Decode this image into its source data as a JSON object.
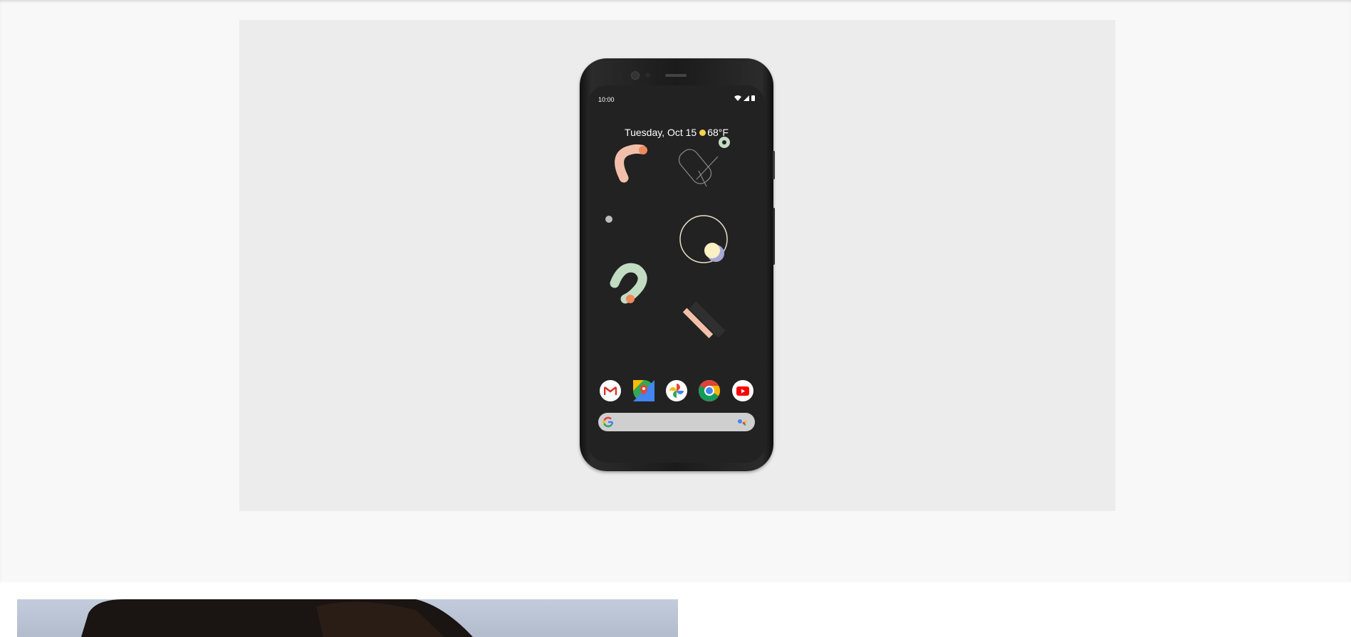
{
  "page": {
    "background": "#ffffff",
    "hero_background": "#ececec",
    "section_background": "#f8f8f8"
  },
  "phone": {
    "status_time": "10:00",
    "status_icons": [
      "wifi-icon",
      "cellular-signal-icon",
      "battery-icon"
    ],
    "date": "Tuesday, Oct 15",
    "weather_icon": "sun-icon",
    "temperature": "68°F",
    "wallpaper_colors": {
      "peach": "#f2c0aa",
      "orange": "#ee8a5c",
      "mint": "#c2dcc4",
      "cream": "#fbefc4",
      "lavender": "#a6a7d6",
      "line": "#bdbdbd"
    },
    "dock_apps": [
      {
        "name": "Gmail",
        "icon": "gmail-icon"
      },
      {
        "name": "Maps",
        "icon": "maps-icon"
      },
      {
        "name": "Photos",
        "icon": "photos-icon"
      },
      {
        "name": "Chrome",
        "icon": "chrome-icon"
      },
      {
        "name": "YouTube",
        "icon": "youtube-icon"
      }
    ],
    "search_bar": {
      "logo_icon": "google-g-icon",
      "assistant_icon": "assistant-dots-icon"
    }
  },
  "next_section": {
    "image_icon": "person-photo"
  }
}
